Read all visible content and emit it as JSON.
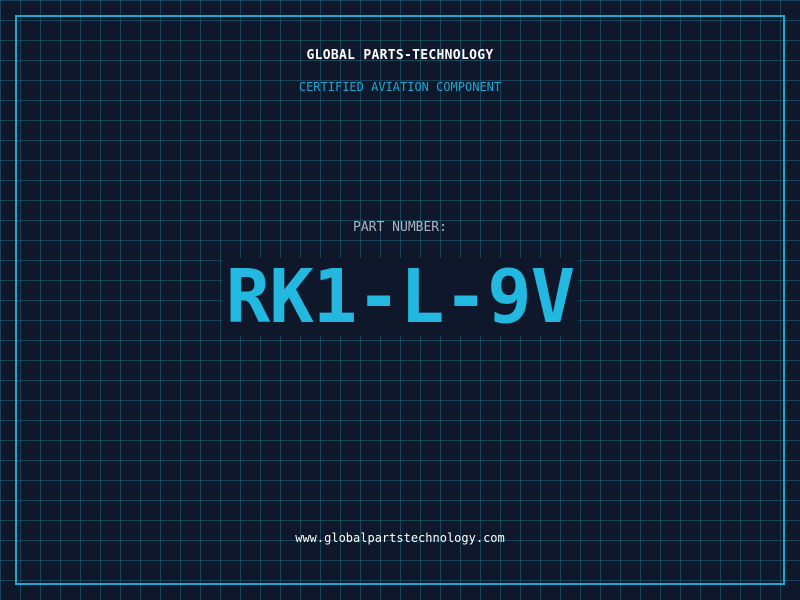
{
  "brand": {
    "name": "GLOBAL PARTS-TECHNOLOGY",
    "subtitle": "CERTIFIED AVIATION COMPONENT"
  },
  "part": {
    "label": "PART NUMBER:",
    "number": "RK1-L-9V"
  },
  "footer": {
    "website": "www.globalpartstechnology.com"
  },
  "colors": {
    "background": "#0f172a",
    "grid": "#2296b4",
    "accent": "#1ea7d1",
    "part_number": "#22b8e0",
    "text": "#ffffff",
    "muted": "#a9b4c4"
  }
}
